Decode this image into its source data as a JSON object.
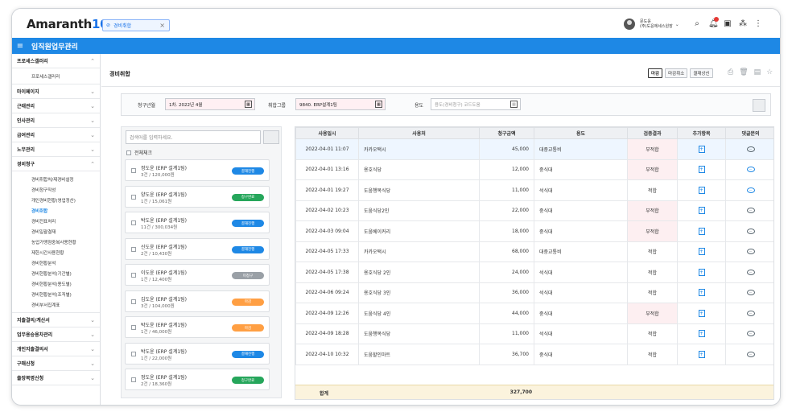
{
  "header": {
    "logo_text": "Amaranth",
    "logo_num": "10",
    "open_tab": "경비취합",
    "user_name": "문도윤",
    "user_org": "(주)도윤에세스원장"
  },
  "nav": {
    "title": "임직원업무관리"
  },
  "sidebar": {
    "menus": [
      {
        "label": "프로세스갤러리",
        "open": true,
        "subs": [
          "프로세스갤러리"
        ]
      },
      {
        "label": "마이페이지",
        "open": false,
        "subs": []
      },
      {
        "label": "근태관리",
        "open": false,
        "subs": []
      },
      {
        "label": "인사관리",
        "open": false,
        "subs": []
      },
      {
        "label": "급여관리",
        "open": false,
        "subs": []
      },
      {
        "label": "노무관리",
        "open": false,
        "subs": []
      },
      {
        "label": "경비청구",
        "open": true,
        "subs": [
          "경비취합처/제경비설정",
          "경비청구작성",
          "개인경비현황(영업정산)",
          "경비취합",
          "경비전표처리",
          "경비일괄결재",
          "농업가맹점중복사용현황",
          "제한시간사용현황",
          "경비현황분석",
          "경비현황분석(기간별)",
          "경비현황분석(용도별)",
          "경비현황분석(조직별)",
          "경비부서집계표"
        ]
      },
      {
        "label": "지출결의/계산서",
        "open": false,
        "subs": []
      },
      {
        "label": "업무용승용차관리",
        "open": false,
        "subs": []
      },
      {
        "label": "개인지출결의서",
        "open": false,
        "subs": []
      },
      {
        "label": "구매신청",
        "open": false,
        "subs": []
      },
      {
        "label": "출장복명신청",
        "open": false,
        "subs": []
      }
    ],
    "active_sub": "경비취합"
  },
  "page": {
    "title": "경비취합",
    "buttons": [
      "마감",
      "마감취소",
      "결재상신"
    ]
  },
  "filter": {
    "period_label": "청구년월",
    "period_value": "1차. 2022년 4월",
    "group_label": "취합그룹",
    "group_value": "9840. ERP설계1팀",
    "usage_label": "용도",
    "usage_placeholder": "용도(경비청구) 코드도움"
  },
  "list": {
    "search_placeholder": "검색어를 입력하세요.",
    "check_all": "전체체크",
    "items": [
      {
        "name": "정도윤 (ERP 설계1팀)",
        "detail": "3건 / 120,000원",
        "tag": "결재진행",
        "tag_color": "blue"
      },
      {
        "name": "양도윤 (ERP 설계1팀)",
        "detail": "1건 / 15,061원",
        "tag": "청구완료",
        "tag_color": "green"
      },
      {
        "name": "박도윤 (ERP 설계1팀)",
        "detail": "11건 / 300,034원",
        "tag": "결재진행",
        "tag_color": "blue"
      },
      {
        "name": "신도윤 (ERP 설계1팀)",
        "detail": "2건 / 10,430원",
        "tag": "결재진행",
        "tag_color": "blue"
      },
      {
        "name": "이도윤 (ERP 설계1팀)",
        "detail": "1건 / 12,400원",
        "tag": "미청구",
        "tag_color": "gray"
      },
      {
        "name": "김도윤 (ERP 설계1팀)",
        "detail": "3건 / 104,000원",
        "tag": "마감",
        "tag_color": "orange"
      },
      {
        "name": "박도윤 (ERP 설계1팀)",
        "detail": "1건 / 46,000원",
        "tag": "마감",
        "tag_color": "orange"
      },
      {
        "name": "박도윤 (ERP 설계1팀)",
        "detail": "1건 / 22,000원",
        "tag": "결재진행",
        "tag_color": "blue"
      },
      {
        "name": "정도윤 (ERP 설계1팀)",
        "detail": "2건 / 18,360원",
        "tag": "청구완료",
        "tag_color": "green"
      }
    ]
  },
  "table": {
    "headers": [
      "사용일시",
      "사용처",
      "청구금액",
      "용도",
      "검증결과",
      "추가항목",
      "댓글문의"
    ],
    "rows": [
      {
        "date": "2022-04-01 11:07",
        "place": "카카오택시",
        "amount": "45,000",
        "usage": "대중교통비",
        "result": "부적합",
        "bad": true
      },
      {
        "date": "2022-04-01 13:16",
        "place": "용호식당",
        "amount": "12,000",
        "usage": "중식대",
        "result": "부적합",
        "bad": true
      },
      {
        "date": "2022-04-01 19:27",
        "place": "도움행복식당",
        "amount": "11,000",
        "usage": "석식대",
        "result": "적합",
        "bad": false
      },
      {
        "date": "2022-04-02 10:23",
        "place": "도움식당2인",
        "amount": "22,000",
        "usage": "중식대",
        "result": "부적합",
        "bad": true
      },
      {
        "date": "2022-04-03 09:04",
        "place": "도움베이커리",
        "amount": "18,000",
        "usage": "중식대",
        "result": "부적합",
        "bad": true
      },
      {
        "date": "2022-04-05 17:33",
        "place": "카카오택시",
        "amount": "68,000",
        "usage": "대중교통비",
        "result": "적합",
        "bad": false
      },
      {
        "date": "2022-04-05 17:38",
        "place": "용호식당 2인",
        "amount": "24,000",
        "usage": "석식대",
        "result": "적합",
        "bad": false
      },
      {
        "date": "2022-04-06 09:24",
        "place": "용호식당 3인",
        "amount": "36,000",
        "usage": "석식대",
        "result": "적합",
        "bad": false
      },
      {
        "date": "2022-04-09 12:26",
        "place": "도움식당 4인",
        "amount": "44,000",
        "usage": "중식대",
        "result": "부적합",
        "bad": true
      },
      {
        "date": "2022-04-09 18:28",
        "place": "도움행복식당",
        "amount": "11,000",
        "usage": "석식대",
        "result": "적합",
        "bad": false
      },
      {
        "date": "2022-04-10 10:32",
        "place": "도움할인마트",
        "amount": "36,700",
        "usage": "중식대",
        "result": "적합",
        "bad": false
      }
    ],
    "total_label": "합계",
    "total_value": "327,700"
  }
}
